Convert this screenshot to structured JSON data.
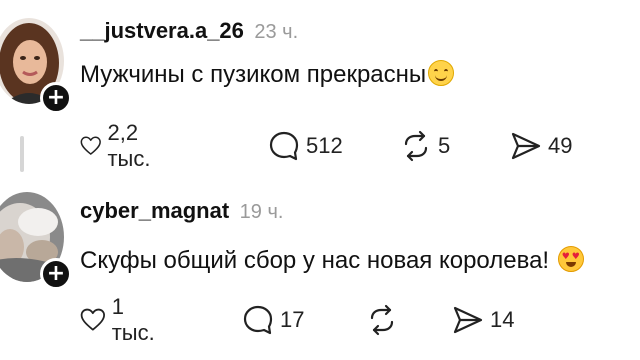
{
  "comments": [
    {
      "username": "__justvera.a_26",
      "time": "23 ч.",
      "text": "Мужчины с пузиком прекрасны",
      "emoji": "smiling-face-icon",
      "likes": "2,2 тыс.",
      "replies": "512",
      "reposts": "5",
      "shares": "49"
    },
    {
      "username": "cyber_magnat",
      "time": "19 ч.",
      "text": "Скуфы общий сбор у нас новая королева!",
      "emoji": "heart-eyes-face-icon",
      "likes": "1 тыс.",
      "replies": "17",
      "reposts": "",
      "shares": "14"
    }
  ]
}
